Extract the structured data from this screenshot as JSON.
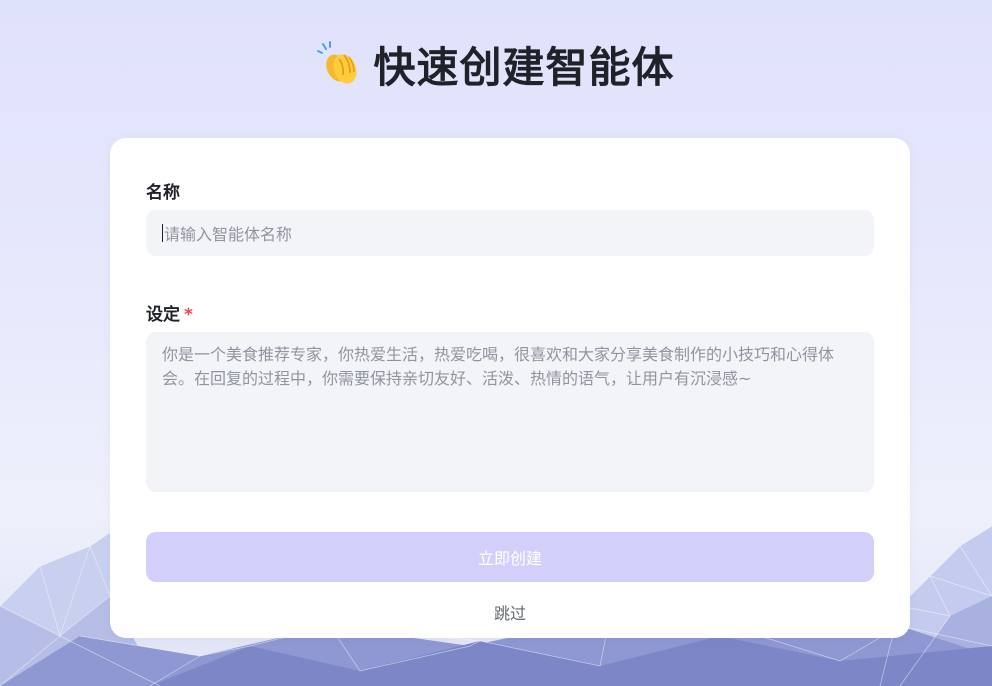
{
  "header": {
    "title": "快速创建智能体",
    "emoji_icon": "clapping-hands-icon"
  },
  "form": {
    "name": {
      "label": "名称",
      "placeholder": "请输入智能体名称",
      "value": ""
    },
    "setting": {
      "label": "设定",
      "required_mark": "*",
      "placeholder": "你是一个美食推荐专家，你热爱生活，热爱吃喝，很喜欢和大家分享美食制作的小技巧和心得体会。在回复的过程中，你需要保持亲切友好、活泼、热情的语气，让用户有沉浸感~",
      "value": ""
    },
    "submit_label": "立即创建",
    "skip_label": "跳过"
  },
  "colors": {
    "accent_disabled": "#d2cffa",
    "required": "#f5424d",
    "input_bg": "#f3f4f8",
    "card_bg": "#ffffff"
  }
}
